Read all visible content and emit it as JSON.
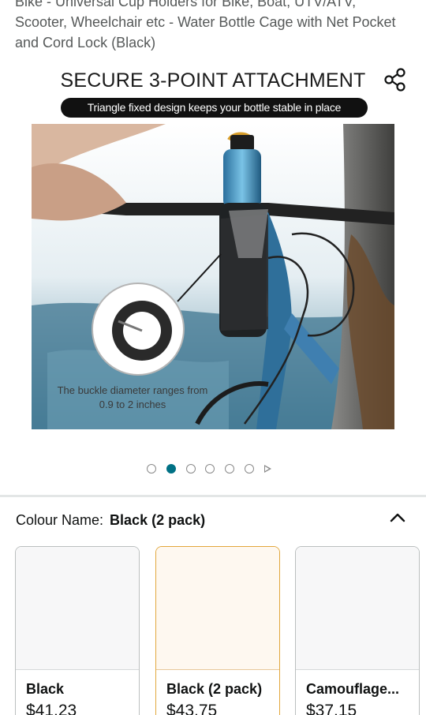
{
  "product": {
    "title": "Bike - Universal Cup Holders for Bike, Boat, UTV/ATV, Scooter, Wheelchair etc - Water Bottle Cage with Net Pocket and Cord Lock (Black)"
  },
  "share": {
    "icon": "share-icon"
  },
  "image": {
    "headline": "SECURE 3-POINT ATTACHMENT",
    "banner": "Triangle fixed design keeps your bottle stable in place",
    "caption": "The buckle diameter ranges from 0.9 to 2 inches"
  },
  "carousel": {
    "count": 6,
    "active_index": 1,
    "next_icon": "play-arrow-icon"
  },
  "variant": {
    "label": "Colour Name:",
    "value": "Black (2 pack)",
    "toggle_icon": "chevron-up-icon"
  },
  "swatches": [
    {
      "name": "Black",
      "price": "$41.23",
      "selected": false
    },
    {
      "name": "Black (2 pack)",
      "price": "$43.75",
      "selected": true
    },
    {
      "name": "Camouflage...",
      "price": "$37.15",
      "selected": false
    }
  ],
  "colors": {
    "accent": "#007185",
    "selected_border": "#e2a73c",
    "text": "#0f1111",
    "muted_text": "#565959"
  }
}
